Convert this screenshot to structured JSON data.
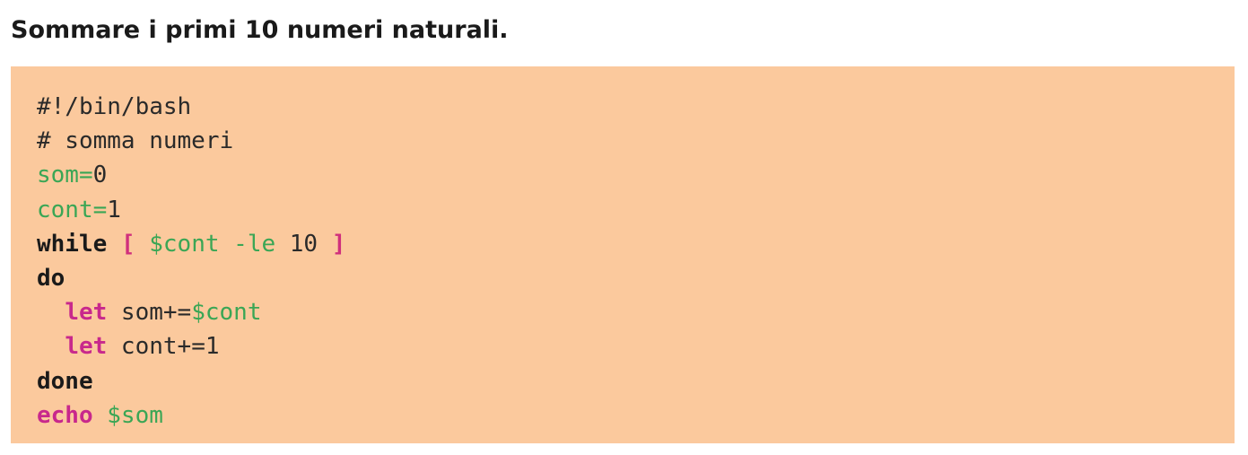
{
  "title": "Sommare i primi 10 numeri naturali.",
  "colors": {
    "code_background": "#fbc99d",
    "variable_green": "#3aa655",
    "keyword_magenta": "#c8288c",
    "bracket_pink": "#d0307c",
    "text_dark": "#2a2a2a"
  },
  "code_lines": [
    [
      {
        "text": "#!/bin/bash",
        "kind": "plain"
      }
    ],
    [
      {
        "text": "# somma numeri",
        "kind": "plain"
      }
    ],
    [
      {
        "text": "som=",
        "kind": "green"
      },
      {
        "text": "0",
        "kind": "plain"
      }
    ],
    [
      {
        "text": "cont=",
        "kind": "green"
      },
      {
        "text": "1",
        "kind": "plain"
      }
    ],
    [
      {
        "text": "while",
        "kind": "keyword"
      },
      {
        "text": " ",
        "kind": "plain"
      },
      {
        "text": "[",
        "kind": "bracket"
      },
      {
        "text": " $cont -le ",
        "kind": "green"
      },
      {
        "text": "10",
        "kind": "plain"
      },
      {
        "text": " ",
        "kind": "plain"
      },
      {
        "text": "]",
        "kind": "bracket"
      }
    ],
    [
      {
        "text": "do",
        "kind": "keyword"
      }
    ],
    [
      {
        "text": "  ",
        "kind": "plain"
      },
      {
        "text": "let",
        "kind": "magenta"
      },
      {
        "text": " som+=",
        "kind": "plain"
      },
      {
        "text": "$cont",
        "kind": "green"
      }
    ],
    [
      {
        "text": "  ",
        "kind": "plain"
      },
      {
        "text": "let",
        "kind": "magenta"
      },
      {
        "text": " cont+=1",
        "kind": "plain"
      }
    ],
    [
      {
        "text": "done",
        "kind": "keyword"
      }
    ],
    [
      {
        "text": "echo",
        "kind": "magenta"
      },
      {
        "text": " ",
        "kind": "plain"
      },
      {
        "text": "$som",
        "kind": "green"
      }
    ]
  ]
}
